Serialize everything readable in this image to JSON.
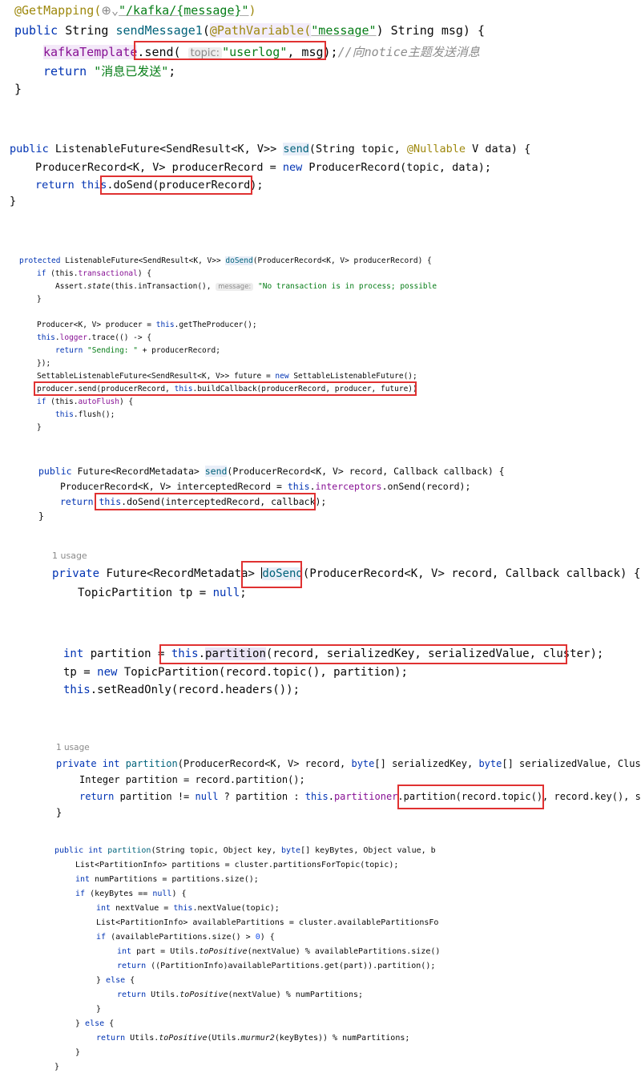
{
  "snippet1": {
    "l1_ann": "@GetMapping(",
    "l1_path": "\"/kafka/{message}\"",
    "l1_close": ")",
    "l2_kw": "public",
    "l2_type": " String ",
    "l2_name": "sendMessage1",
    "l2_p": "(",
    "l2_pv": "@PathVariable(",
    "l2_msgstr": "\"message\"",
    "l2_rest": ") String msg) {",
    "l3_field": "kafkaTemplate",
    "l3_call": ".send( ",
    "l3_hint": "topic:",
    "l3_topic": "\"userlog\"",
    "l3_rest": ", msg);",
    "l3_comment": "//向notice主题发送消息",
    "l4_kw": "return",
    "l4_str": "\"消息已发送\"",
    "l4_end": ";",
    "l5": "}"
  },
  "snippet2": {
    "l1_kw": "public",
    "l1_type": " ListenableFuture<SendResult<K, V>> ",
    "l1_name": "send",
    "l1_p": "(String topic, ",
    "l1_ann": "@Nullable",
    "l1_rest": " V data) {",
    "l2_a": "ProducerRecord<K, V> producerRecord = ",
    "l2_kw": "new",
    "l2_b": " ProducerRecord(topic, data);",
    "l3_kw": "return",
    "l3_this": " this",
    "l3_rest": ".doSend(producerRecord);",
    "l4": "}"
  },
  "snippet3": {
    "l1_kw": "protected",
    "l1_type": " ListenableFuture<SendResult<K, V>> ",
    "l1_name": "doSend",
    "l1_rest": "(ProducerRecord<K, V> producerRecord) {",
    "l2_kw": "if",
    "l2_this": " (this.",
    "l2_fld": "transactional",
    "l2_rest": ") {",
    "l3_a": "Assert.",
    "l3_m": "state",
    "l3_b": "(this.inTransaction(), ",
    "l3_hint": "message:",
    "l3_str": " \"No transaction is in process; possible",
    "l4": "}",
    "l6_a": "Producer<K, V> producer = ",
    "l6_this": "this",
    "l6_b": ".getTheProducer();",
    "l7_this": "this",
    "l7_dot": ".",
    "l7_fld": "logger",
    "l7_rest": ".trace(() -> {",
    "l8_kw": "return",
    "l8_str": " \"Sending: \"",
    "l8_rest": " + producerRecord;",
    "l9": "});",
    "l10_a": "SettableListenableFuture<SendResult<K, V>> future = ",
    "l10_kw": "new",
    "l10_b": " SettableListenableFuture();",
    "l11_a": "producer.send(producerRecord, ",
    "l11_this": "this",
    "l11_b": ".buildCallback(producerRecord, producer, future))",
    "l12_kw": "if",
    "l12_a": " (this.",
    "l12_fld": "autoFlush",
    "l12_b": ") {",
    "l13_this": "this",
    "l13_b": ".flush();",
    "l14": "}"
  },
  "snippet4": {
    "l1_kw": "public",
    "l1_type": " Future<RecordMetadata> ",
    "l1_name": "send",
    "l1_rest": "(ProducerRecord<K, V> record, Callback callback) {",
    "l2_a": "ProducerRecord<K, V> interceptedRecord = ",
    "l2_this": "this",
    "l2_dot": ".",
    "l2_fld": "interceptors",
    "l2_b": ".onSend(record);",
    "l3_kw": "return",
    "l3_this": " this",
    "l3_b": ".doSend(interceptedRecord, callback);",
    "l4": "}"
  },
  "snippet5": {
    "usage": "1 usage",
    "l1_kw": "private",
    "l1_type": " Future<RecordMetadata> ",
    "l1_name": "doSend",
    "l1_rest": "(ProducerRecord<K, V> record, Callback callback) {",
    "l2_a": "TopicPartition tp = ",
    "l2_kw": "null",
    "l2_b": ";"
  },
  "snippet6": {
    "l1_kw": "int",
    "l1_a": " partition = ",
    "l1_this": "this",
    "l1_dot": ".",
    "l1_m": "partition",
    "l1_b": "(record, serializedKey, serializedValue, cluster);",
    "l2_a": "tp = ",
    "l2_kw": "new",
    "l2_b": " TopicPartition(record.topic(), partition);",
    "l3_this": "this",
    "l3_b": ".setReadOnly(record.headers());"
  },
  "snippet7": {
    "usage": "1 usage",
    "l1_kw": "private int",
    "l1_name": " partition",
    "l1_a": "(ProducerRecord<K, V> record, ",
    "l1_kw2": "byte",
    "l1_b": "[] serializedKey, ",
    "l1_kw3": "byte",
    "l1_c": "[] serializedValue, Clus",
    "l2": "Integer partition = record.partition();",
    "l3_kw": "return",
    "l3_a": " partition != ",
    "l3_null": "null",
    "l3_b": " ? partition : ",
    "l3_this": "this",
    "l3_dot": ".",
    "l3_fld": "partitioner",
    "l3_c": ".partition(record.topic(), record.key(), s",
    "l4": "}"
  },
  "snippet8": {
    "l1_kw": "public int",
    "l1_name": " partition",
    "l1_a": "(String topic, Object key, ",
    "l1_kw2": "byte",
    "l1_b": "[] keyBytes, Object value, b",
    "l2": "List<PartitionInfo> partitions = cluster.partitionsForTopic(topic);",
    "l3_kw": "int",
    "l3_a": " numPartitions = partitions.size();",
    "l4_kw": "if",
    "l4_a": " (keyBytes == ",
    "l4_null": "null",
    "l4_b": ") {",
    "l5_kw": "int",
    "l5_a": " nextValue = ",
    "l5_this": "this",
    "l5_b": ".nextValue(topic);",
    "l6": "List<PartitionInfo> availablePartitions = cluster.availablePartitionsFo",
    "l7_kw": "if",
    "l7_a": " (availablePartitions.size() > ",
    "l7_num": "0",
    "l7_b": ") {",
    "l8_kw": "int",
    "l8_a": " part = Utils.",
    "l8_m": "toPositive",
    "l8_b": "(nextValue) % availablePartitions.size()",
    "l9_kw": "return",
    "l9_a": " ((PartitionInfo)availablePartitions.get(part)).partition();",
    "l10_a": "} ",
    "l10_kw": "else",
    "l10_b": " {",
    "l11_kw": "return",
    "l11_a": " Utils.",
    "l11_m": "toPositive",
    "l11_b": "(nextValue) % numPartitions;",
    "l12": "}",
    "l13_a": "} ",
    "l13_kw": "else",
    "l13_b": " {",
    "l14_kw": "return",
    "l14_a": " Utils.",
    "l14_m": "toPositive",
    "l14_b": "(Utils.",
    "l14_m2": "murmur2",
    "l14_c": "(keyBytes)) % numPartitions;",
    "l15": "}",
    "l16": "}"
  }
}
